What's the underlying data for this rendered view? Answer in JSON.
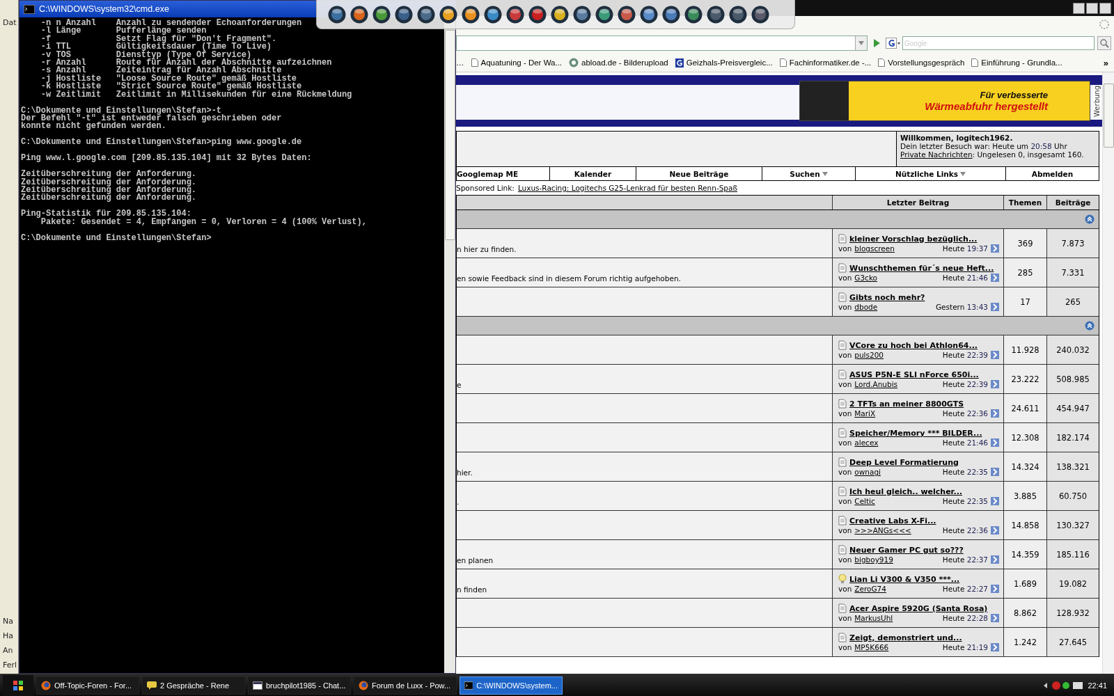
{
  "left_strip": {
    "top_texts": [
      "Dat"
    ],
    "bottom_texts": [
      "Na",
      "Ha",
      "An",
      "Ferl"
    ]
  },
  "cmd": {
    "title": "C:\\WINDOWS\\system32\\cmd.exe",
    "blocks": [
      [
        "    -n n Anzahl    Anzahl zu sendender Echoanforderungen",
        "    -l Länge       Pufferlänge senden",
        "    -f             Setzt Flag für \"Don't Fragment\".",
        "    -i TTL         Gültigkeitsdauer (Time To Live)",
        "    -v TOS         Diensttyp (Type Of Service)",
        "    -r Anzahl      Route für Anzahl der Abschnitte aufzeichnen",
        "    -s Anzahl      Zeiteintrag für Anzahl Abschnitte",
        "    -j Hostliste   \"Loose Source Route\" gemäß Hostliste",
        "    -k Hostliste   \"Strict Source Route\" gemäß Hostliste",
        "    -w Zeitlimit   Zeitlimit in Millisekunden für eine Rückmeldung"
      ],
      [
        "C:\\Dokumente und Einstellungen\\Stefan>-t",
        "Der Befehl \"-t\" ist entweder falsch geschrieben oder",
        "konnte nicht gefunden werden."
      ],
      [
        "C:\\Dokumente und Einstellungen\\Stefan>ping www.google.de"
      ],
      [
        "Ping www.l.google.com [209.85.135.104] mit 32 Bytes Daten:"
      ],
      [
        "Zeitüberschreitung der Anforderung.",
        "Zeitüberschreitung der Anforderung.",
        "Zeitüberschreitung der Anforderung.",
        "Zeitüberschreitung der Anforderung."
      ],
      [
        "Ping-Statistik für 209.85.135.104:",
        "    Pakete: Gesendet = 4, Empfangen = 0, Verloren = 4 (100% Verlust),"
      ],
      [
        "C:\\Dokumente und Einstellungen\\Stefan>"
      ]
    ]
  },
  "browser": {
    "search_placeholder": "Google",
    "bookmarks": [
      {
        "label": "…",
        "kind": "none"
      },
      {
        "label": "Aquatuning - Der Wa...",
        "kind": "page"
      },
      {
        "label": "abload.de - Bilderupload",
        "kind": "abload"
      },
      {
        "label": "Geizhals-Preisvergleic...",
        "kind": "geizhals"
      },
      {
        "label": "Fachinformatiker.de -...",
        "kind": "page"
      },
      {
        "label": "Vorstellungsgespräch",
        "kind": "page"
      },
      {
        "label": "Einführung - Grundla...",
        "kind": "page"
      }
    ],
    "bookmarks_more": "»"
  },
  "banner": {
    "headline": "Für verbesserte",
    "subline": "Wärmeabfuhr hergestellt",
    "side_label": "Werbung"
  },
  "welcome": {
    "greeting": "Willkommen, logitech1962.",
    "last_visit": "Dein letzter Besuch war: Heute um",
    "last_visit_time": "20:58",
    "last_visit_suffix": "Uhr",
    "pm_link": "Private Nachrichten",
    "pm_text": ": Ungelesen 0, insgesamt 160."
  },
  "nav": [
    {
      "label": "Googlemap ME",
      "menu": false
    },
    {
      "label": "Kalender",
      "menu": false
    },
    {
      "label": "Neue Beiträge",
      "menu": false
    },
    {
      "label": "Suchen",
      "menu": true
    },
    {
      "label": "Nützliche Links",
      "menu": true
    },
    {
      "label": "Abmelden",
      "menu": false
    }
  ],
  "sponsored": {
    "label": "Sponsored Link:",
    "link": "Luxus-Racing: Logitechs G25-Lenkrad für besten Renn-Spaß"
  },
  "table": {
    "columns": [
      "Letzter Beitrag",
      "Themen",
      "Beiträge"
    ],
    "sections": [
      {
        "rows": [
          {
            "description": "n hier zu finden.",
            "title": "kleiner Vorschlag bezüglich...",
            "by": "von",
            "author": "blogscreen",
            "day": "Heute",
            "time": "19:37",
            "topics": "369",
            "posts": "7.873",
            "kind": "doc"
          },
          {
            "description": "en sowie Feedback sind in diesem Forum richtig aufgehoben.",
            "title": "Wunschthemen für´s neue Heft...",
            "by": "von",
            "author": "G3cko",
            "day": "Heute",
            "time": "21:46",
            "topics": "285",
            "posts": "7.331",
            "kind": "doc"
          },
          {
            "title": "Gibts noch mehr?",
            "by": "von",
            "author": "dbode",
            "day": "Gestern",
            "time": "13:43",
            "topics": "17",
            "posts": "265",
            "kind": "doc"
          }
        ]
      },
      {
        "rows": [
          {
            "title": "VCore zu hoch bei Athlon64...",
            "by": "von",
            "author": "puls200",
            "day": "Heute",
            "time": "22:39",
            "topics": "11.928",
            "posts": "240.032",
            "kind": "doc"
          },
          {
            "description": "e",
            "title": "ASUS P5N-E SLI nForce 650i...",
            "by": "von",
            "author": "Lord.Anubis",
            "day": "Heute",
            "time": "22:39",
            "topics": "23.222",
            "posts": "508.985",
            "kind": "doc"
          },
          {
            "title": "2 TFTs an meiner 8800GTS",
            "by": "von",
            "author": "MariX",
            "day": "Heute",
            "time": "22:36",
            "topics": "24.611",
            "posts": "454.947",
            "kind": "doc"
          },
          {
            "title": "Speicher/Memory *** BILDER...",
            "by": "von",
            "author": "alecex",
            "day": "Heute",
            "time": "21:46",
            "topics": "12.308",
            "posts": "182.174",
            "kind": "doc"
          },
          {
            "description": "hier.",
            "title": "Deep Level Formatierung",
            "by": "von",
            "author": "ownagi",
            "day": "Heute",
            "time": "22:35",
            "topics": "14.324",
            "posts": "138.321",
            "kind": "doc"
          },
          {
            "description": ".",
            "title": "Ich heul gleich.. welcher...",
            "by": "von",
            "author": "Celtic",
            "day": "Heute",
            "time": "22:35",
            "topics": "3.885",
            "posts": "60.750",
            "kind": "doc"
          },
          {
            "title": "Creative Labs X-Fi...",
            "by": "von",
            "author": ">>>ANGs<<<",
            "day": "Heute",
            "time": "22:36",
            "topics": "14.858",
            "posts": "130.327",
            "kind": "doc"
          },
          {
            "description": "en planen",
            "title": "Neuer Gamer PC gut so???",
            "by": "von",
            "author": "bigboy919",
            "day": "Heute",
            "time": "22:37",
            "topics": "14.359",
            "posts": "185.116",
            "kind": "doc"
          },
          {
            "description": "n finden",
            "title": "Lian Li V300 & V350 ***...",
            "by": "von",
            "author": "ZeroG74",
            "day": "Heute",
            "time": "22:27",
            "topics": "1.689",
            "posts": "19.082",
            "kind": "bulb"
          },
          {
            "title": "Acer Aspire 5920G (Santa Rosa)",
            "by": "von",
            "author": "MarkusUhl",
            "day": "Heute",
            "time": "22:28",
            "topics": "8.862",
            "posts": "128.932",
            "kind": "doc"
          },
          {
            "title": "Zeigt, demonstriert und...",
            "by": "von",
            "author": "MP5K666",
            "day": "Heute",
            "time": "21:19",
            "topics": "1.242",
            "posts": "27.645",
            "kind": "doc"
          }
        ]
      }
    ]
  },
  "taskbar": {
    "tasks": [
      {
        "label": "Off-Topic-Foren - For...",
        "kind": "firefox",
        "selected": false
      },
      {
        "label": "2 Gespräche - Rene",
        "kind": "chat",
        "selected": false
      },
      {
        "label": "bruchpilot1985 - Chat...",
        "kind": "window",
        "selected": false
      },
      {
        "label": "Forum de Luxx - Pow...",
        "kind": "firefox",
        "selected": false
      },
      {
        "label": "C:\\WINDOWS\\system...",
        "kind": "cmd",
        "selected": true
      }
    ],
    "clock": "22:41"
  }
}
